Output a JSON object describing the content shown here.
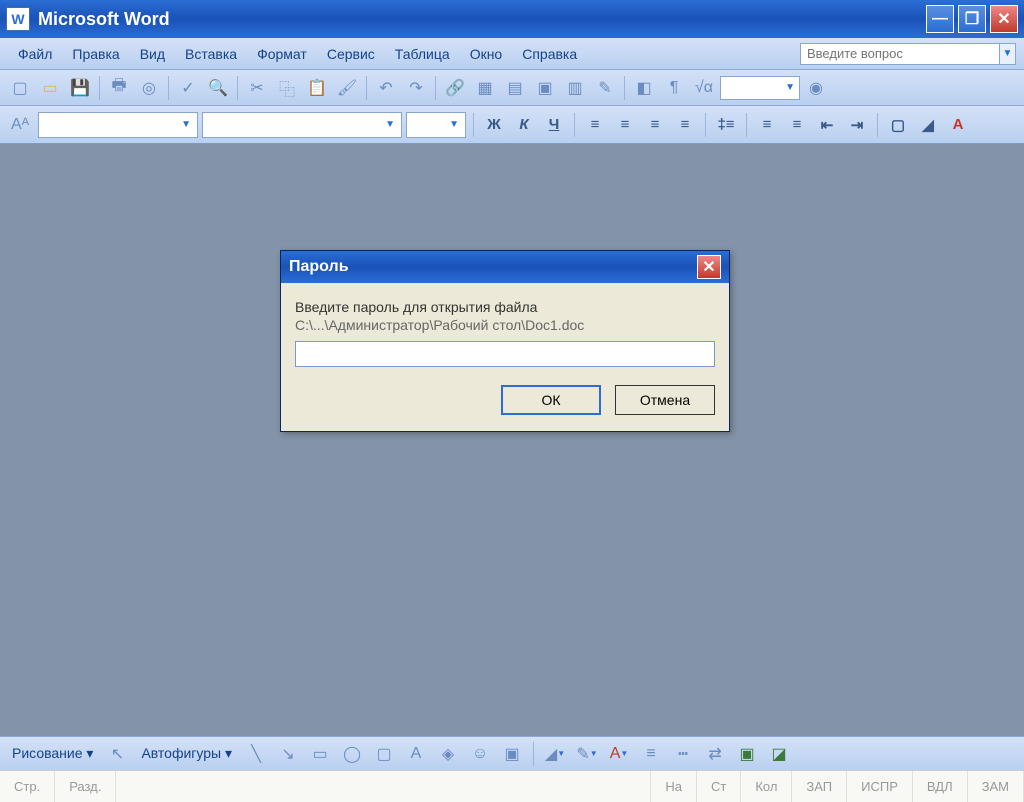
{
  "titlebar": {
    "app_icon_letter": "W",
    "title": "Microsoft Word"
  },
  "menu": {
    "items": [
      "Файл",
      "Правка",
      "Вид",
      "Вставка",
      "Формат",
      "Сервис",
      "Таблица",
      "Окно",
      "Справка"
    ],
    "help_placeholder": "Введите вопрос"
  },
  "format_toolbar": {
    "bold": "Ж",
    "italic": "К",
    "underline": "Ч"
  },
  "dialog": {
    "title": "Пароль",
    "prompt": "Введите пароль для открытия файла",
    "path": "C:\\...\\Администратор\\Рабочий стол\\Doc1.doc",
    "ok": "ОК",
    "cancel": "Отмена"
  },
  "drawing": {
    "label": "Рисование",
    "autoshapes": "Автофигуры"
  },
  "status": {
    "page": "Стр.",
    "section": "Разд.",
    "at": "На",
    "line": "Ст",
    "col": "Кол",
    "rec": "ЗАП",
    "fix": "ИСПР",
    "ext": "ВДЛ",
    "ovr": "ЗАМ"
  }
}
